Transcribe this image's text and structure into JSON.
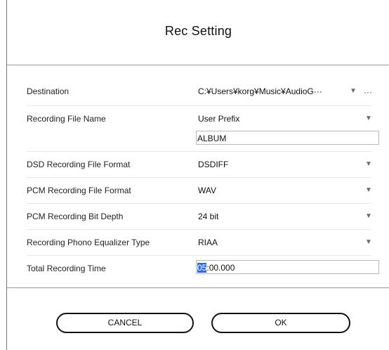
{
  "dialog": {
    "title": "Rec Setting"
  },
  "settings": {
    "destination": {
      "label": "Destination",
      "value": "C:¥Users¥korg¥Music¥AudioG···",
      "arrow": "▼",
      "more": "···"
    },
    "recording_file_name": {
      "label": "Recording File Name",
      "value": "User Prefix",
      "arrow": "▼",
      "input_value": "ALBUM"
    },
    "dsd_format": {
      "label": "DSD Recording File Format",
      "value": "DSDIFF",
      "arrow": "▼"
    },
    "pcm_format": {
      "label": "PCM Recording File Format",
      "value": "WAV",
      "arrow": "▼"
    },
    "pcm_bit_depth": {
      "label": "PCM Recording Bit Depth",
      "value": "24 bit",
      "arrow": "▼"
    },
    "phono_eq": {
      "label": "Recording Phono Equalizer Type",
      "value": "RIAA",
      "arrow": "▼"
    },
    "total_time": {
      "label": "Total Recording Time",
      "value_selected": "05",
      "value_rest": ":00.000"
    }
  },
  "buttons": {
    "cancel": "CANCEL",
    "ok": "OK"
  },
  "colors": {
    "selection": "#2d6be0",
    "divider": "#9a9a9a",
    "row_divider": "#e6e6e6",
    "text": "#111111",
    "arrow": "#6b6b6b"
  }
}
